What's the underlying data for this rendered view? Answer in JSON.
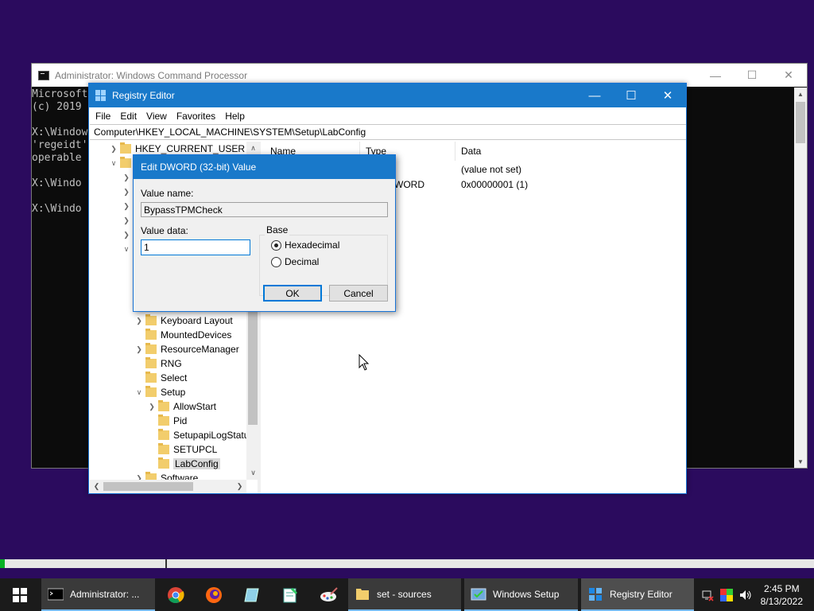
{
  "cmd": {
    "title": "Administrator: Windows Command Processor",
    "lines": [
      "Microsoft",
      "(c) 2019",
      "",
      "X:\\Window",
      "'regeidt'",
      "operable",
      "",
      "X:\\Windo",
      "",
      "X:\\Windo"
    ]
  },
  "regedit": {
    "title": "Registry Editor",
    "menu": [
      "File",
      "Edit",
      "View",
      "Favorites",
      "Help"
    ],
    "address": "Computer\\HKEY_LOCAL_MACHINE\\SYSTEM\\Setup\\LabConfig",
    "tree_top": "HKEY_CURRENT_USER",
    "tree": [
      {
        "label": "Keyboard Layout"
      },
      {
        "label": "MountedDevices"
      },
      {
        "label": "ResourceManager"
      },
      {
        "label": "RNG"
      },
      {
        "label": "Select"
      },
      {
        "label": "Setup"
      },
      {
        "label": "AllowStart"
      },
      {
        "label": "Pid"
      },
      {
        "label": "SetupapiLogStatu"
      },
      {
        "label": "SETUPCL"
      },
      {
        "label": "LabConfig"
      },
      {
        "label": "Software"
      }
    ],
    "columns": {
      "name": "Name",
      "type": "Type",
      "data": "Data"
    },
    "rows": [
      {
        "type": "",
        "data": "(value not set)"
      },
      {
        "type": "WORD",
        "data": "0x00000001 (1)"
      }
    ]
  },
  "dialog": {
    "title": "Edit DWORD (32-bit) Value",
    "value_name_label": "Value name:",
    "value_name": "BypassTPMCheck",
    "value_data_label": "Value data:",
    "value_data": "1",
    "base_label": "Base",
    "hex_label": "Hexadecimal",
    "dec_label": "Decimal",
    "base_selected": "Hexadecimal",
    "ok": "OK",
    "cancel": "Cancel"
  },
  "progress": {
    "fraction": 0.006
  },
  "taskbar": {
    "cmd": "Administrator: ...",
    "explorer": "set - sources",
    "setup": "Windows Setup",
    "regedit": "Registry Editor",
    "time": "2:45 PM",
    "date": "8/13/2022"
  },
  "colors": {
    "titlebar": "#1979ca",
    "desktop": "#2b0b5e",
    "progress": "#06b025"
  }
}
